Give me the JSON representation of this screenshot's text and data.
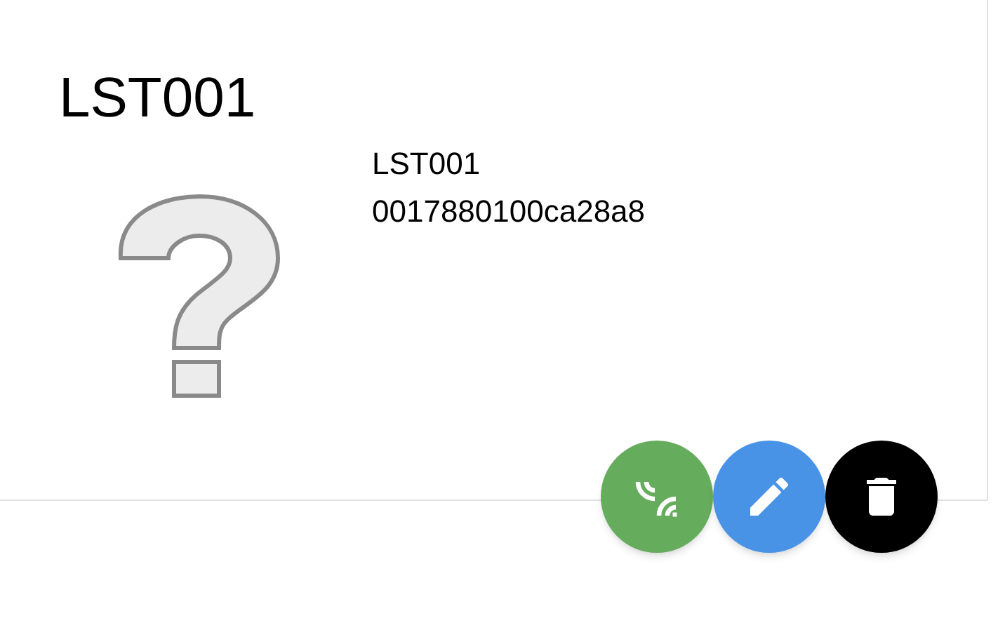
{
  "title": "LST001",
  "device": {
    "name": "LST001",
    "address": "0017880100ca28a8"
  },
  "actions": [
    {
      "kind": "signal"
    },
    {
      "kind": "edit"
    },
    {
      "kind": "delete"
    }
  ]
}
